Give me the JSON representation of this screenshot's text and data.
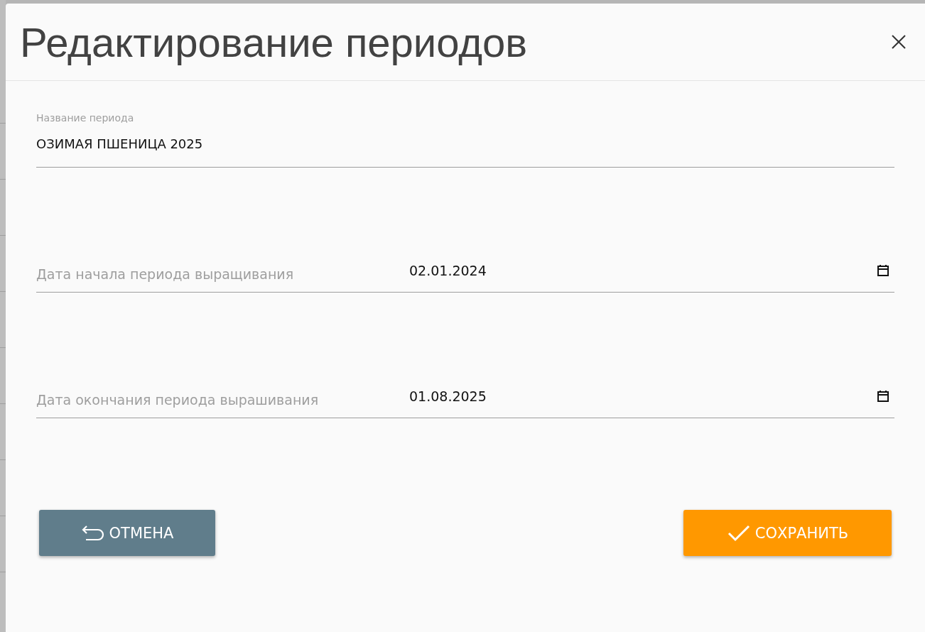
{
  "dialog": {
    "title": "Редактирование периодов"
  },
  "name_field": {
    "label": "Название периода",
    "value": "ОЗИМАЯ ПШЕНИЦА 2025"
  },
  "date_fields": [
    {
      "label": "Дата начала периода выращивания",
      "value": "02.01.2024"
    },
    {
      "label": "Дата окончания периода вырашивания",
      "value": "01.08.2025"
    }
  ],
  "buttons": [
    {
      "kind": "cancel",
      "label": "ОТМЕНА"
    },
    {
      "kind": "save",
      "label": "СОХРАНИТЬ"
    }
  ]
}
